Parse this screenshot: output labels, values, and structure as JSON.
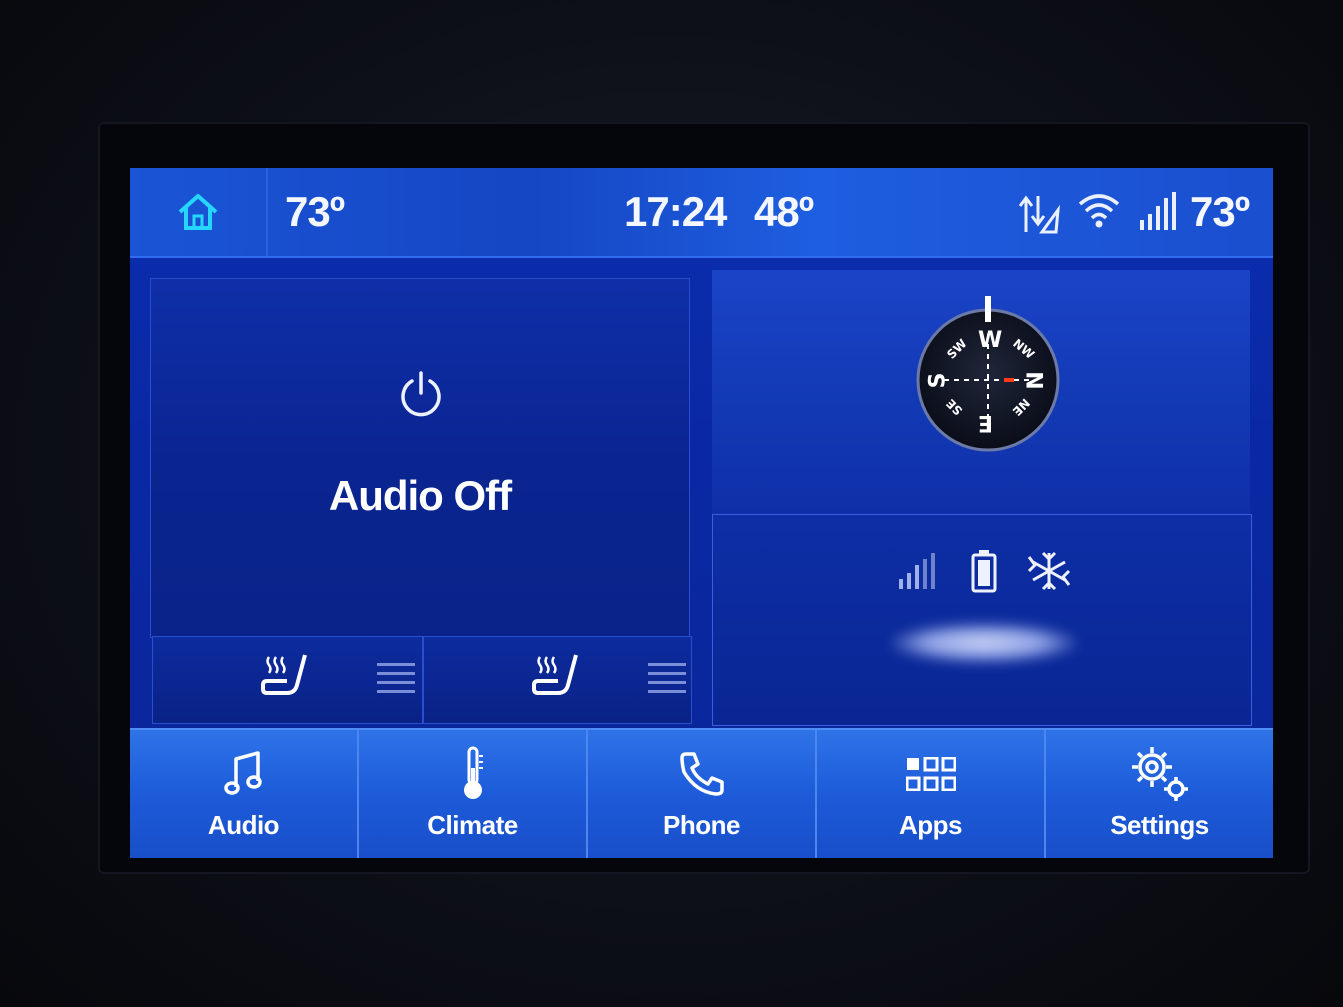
{
  "status_bar": {
    "inside_temp": "73º",
    "time": "17:24",
    "outside_temp": "48º",
    "right_temp": "73º",
    "icons": [
      "home-icon",
      "navigation-sync-icon",
      "wifi-icon",
      "cell-signal-icon"
    ]
  },
  "audio": {
    "status_label": "Audio Off",
    "icon": "power-icon"
  },
  "seats": {
    "icons": [
      "driver-heated-seat-icon",
      "passenger-heated-seat-icon"
    ]
  },
  "compass": {
    "labels": [
      "W",
      "NW",
      "N",
      "NE",
      "E",
      "SE",
      "S",
      "SW"
    ]
  },
  "phone_status": {
    "icons": [
      "phone-signal-icon",
      "phone-battery-icon",
      "bluetooth-icon"
    ]
  },
  "nav": {
    "audio": "Audio",
    "climate": "Climate",
    "phone": "Phone",
    "apps": "Apps",
    "settings": "Settings"
  },
  "colors": {
    "screen_bg": "#0a2fb0",
    "status_bar_bg": "#1a55d6",
    "nav_bg": "#1d5bd9",
    "home_icon": "#25d6ff",
    "compass_needle": "#ff3a1a"
  }
}
